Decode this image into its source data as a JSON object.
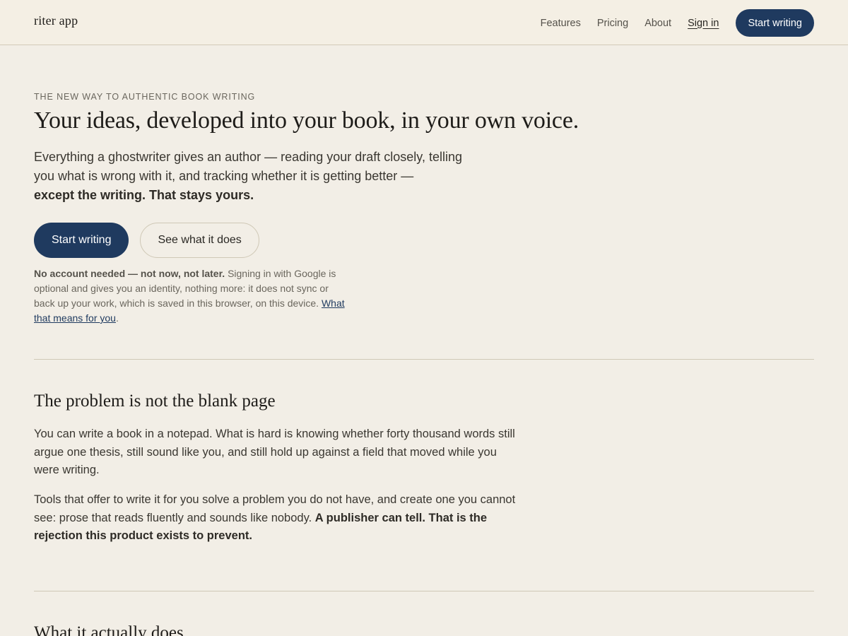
{
  "header": {
    "brand": "riter app",
    "nav": [
      {
        "label": "Features"
      },
      {
        "label": "Pricing"
      },
      {
        "label": "About"
      },
      {
        "label": "Sign in"
      }
    ],
    "cta_label": "Start writing"
  },
  "hero": {
    "eyebrow": "THE NEW WAY TO AUTHENTIC BOOK WRITING",
    "headline": "Your ideas, developed into your book, in your own voice.",
    "lede_text": "Everything a ghostwriter gives an author — reading your draft closely, telling you what is wrong with it, and tracking whether it is getting better —",
    "lede_emphasis": "except the writing. That stays yours.",
    "primary_button": "Start writing",
    "secondary_button": "See what it does",
    "note_emphasis": "No account needed — not now, not later.",
    "note_text": "Signing in with Google is optional and gives you an identity, nothing more: it does not sync or back up your work, which is saved in this browser, on this device.",
    "note_link": "What that means for you",
    "note_end": "."
  },
  "problem_section": {
    "title": "The problem is not the blank page",
    "para1": "You can write a book in a notepad. What is hard is knowing whether forty thousand words still argue one thesis, still sound like you, and still hold up against a field that moved while you were writing.",
    "para2_text": "Tools that offer to write it for you solve a problem you do not have, and create one you cannot see: prose that reads fluently and sounds like nobody.",
    "para2_emphasis": "A publisher can tell. That is the rejection this product exists to prevent."
  },
  "next_section": {
    "title": "What it actually does"
  },
  "colors": {
    "background": "#f2eee6",
    "accent": "#1f3a5f",
    "rule": "#cfc8b6"
  }
}
